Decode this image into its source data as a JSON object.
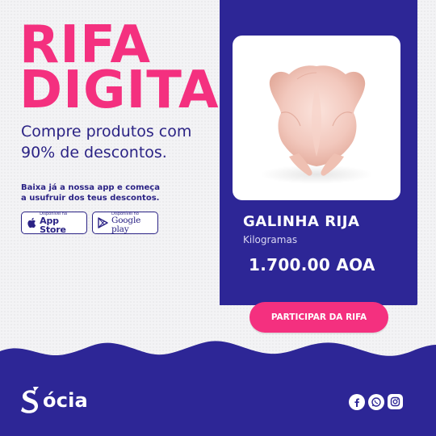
{
  "title": {
    "line1": "RIFA",
    "line2": "DIGITAL"
  },
  "subtitle": {
    "line1": "Compre produtos com",
    "line2": "90% de descontos."
  },
  "info": {
    "line1": "Baixa já a nossa app e começa",
    "line2": "a usufruir dos teus descontos."
  },
  "stores": {
    "apple": {
      "small": "Disponível na",
      "big": "App Store",
      "icon": "apple-icon"
    },
    "google": {
      "small": "Disponível no",
      "big": "Google play",
      "icon": "play-icon"
    }
  },
  "product": {
    "image": "raw-chicken",
    "name": "GALINHA RIJA",
    "unit": "Kilogramas",
    "price": "1.700.00 AOA"
  },
  "cta": {
    "label": "PARTICIPAR DA RIFA"
  },
  "brand": {
    "name": "ócia",
    "logo": "socia-logo"
  },
  "socials": [
    "facebook-icon",
    "whatsapp-icon",
    "instagram-icon"
  ],
  "colors": {
    "pink": "#f4307f",
    "indigo": "#2d2696",
    "background": "#f3f3f5"
  }
}
